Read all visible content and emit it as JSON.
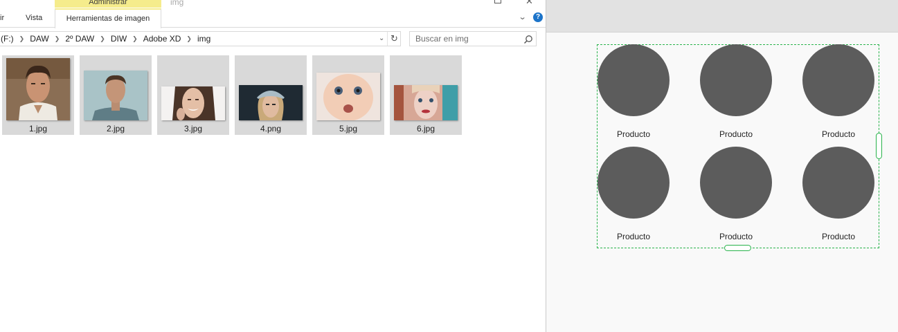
{
  "explorer": {
    "window_title": "img",
    "ribbon": {
      "context_header": "Administrar",
      "tabs": [
        "ir",
        "Vista",
        "Herramientas de imagen"
      ],
      "help_label": "?"
    },
    "address": {
      "breadcrumb": [
        "(F:)",
        "DAW",
        "2º DAW",
        "DIW",
        "Adobe XD",
        "img"
      ]
    },
    "search": {
      "placeholder": "Buscar en img"
    },
    "files": [
      {
        "name": "1.jpg"
      },
      {
        "name": "2.jpg"
      },
      {
        "name": "3.jpg"
      },
      {
        "name": "4.png"
      },
      {
        "name": "5.jpg"
      },
      {
        "name": "6.jpg"
      }
    ]
  },
  "xd": {
    "products": [
      {
        "label": "Producto"
      },
      {
        "label": "Producto"
      },
      {
        "label": "Producto"
      },
      {
        "label": "Producto"
      },
      {
        "label": "Producto"
      },
      {
        "label": "Producto"
      }
    ],
    "colors": {
      "circle": "#5c5c5c",
      "selection": "#27b24a"
    }
  }
}
